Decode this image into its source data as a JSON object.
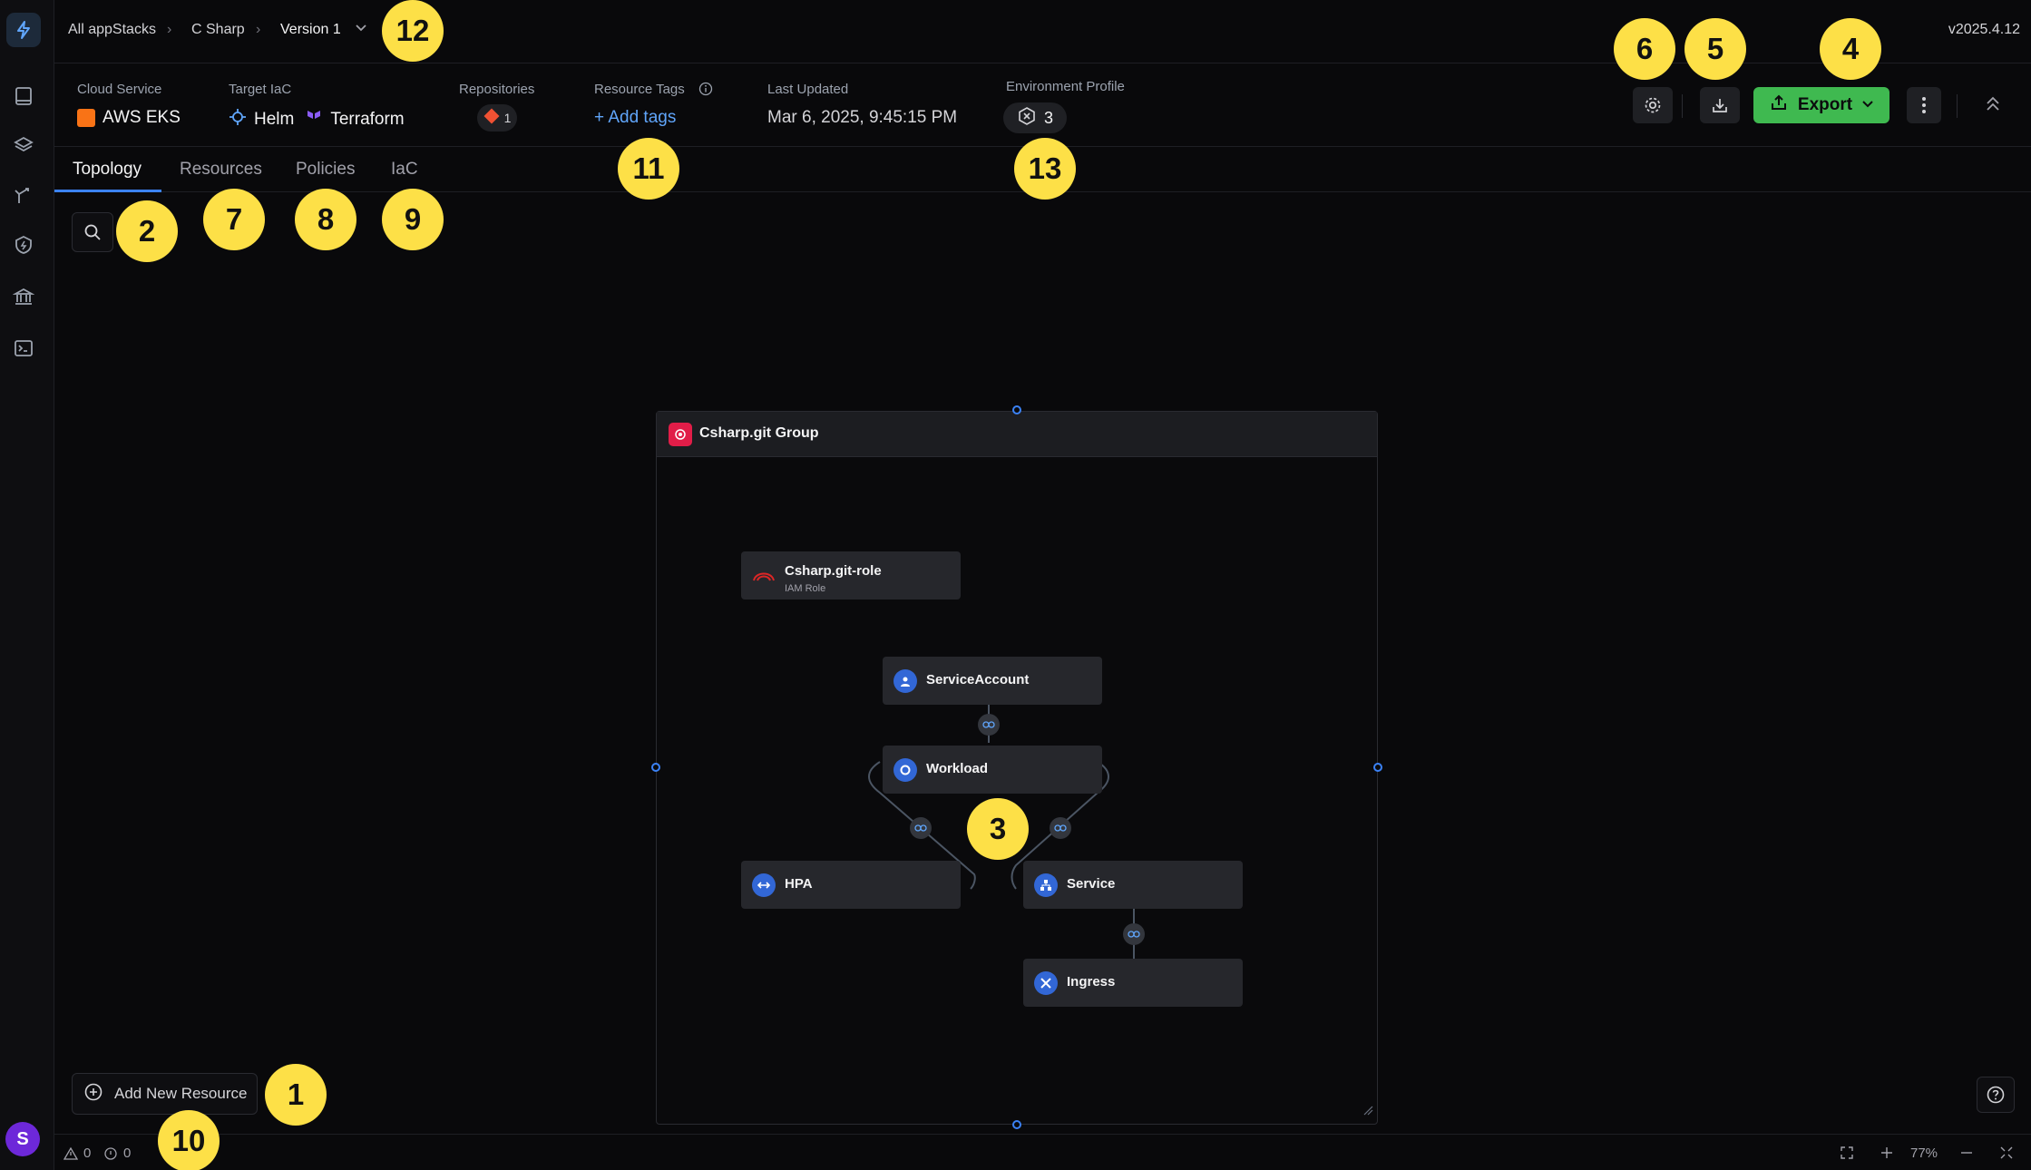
{
  "breadcrumb": {
    "items": [
      "All appStacks",
      "C Sharp"
    ],
    "version": "Version 1"
  },
  "app_version": "v2025.4.12",
  "header": {
    "cloud_service_label": "Cloud Service",
    "cloud_service_value": "AWS EKS",
    "target_iac_label": "Target IaC",
    "target_iac_values": [
      "Helm",
      "Terraform"
    ],
    "repositories_label": "Repositories",
    "repositories_count": "1",
    "resource_tags_label": "Resource Tags",
    "add_tags": "+ Add tags",
    "last_updated_label": "Last Updated",
    "last_updated_value": "Mar 6, 2025, 9:45:15 PM",
    "env_profile_label": "Environment Profile",
    "env_profile_count": "3",
    "export_label": "Export"
  },
  "tabs": [
    "Topology",
    "Resources",
    "Policies",
    "IaC"
  ],
  "active_tab": "Topology",
  "topology": {
    "group_title": "Csharp.git Group",
    "nodes": [
      {
        "label": "Csharp.git-role",
        "sub": "IAM Role",
        "icon": "iam-role-icon"
      },
      {
        "label": "ServiceAccount",
        "icon": "service-account-icon"
      },
      {
        "label": "Workload",
        "icon": "workload-icon"
      },
      {
        "label": "HPA",
        "icon": "hpa-icon"
      },
      {
        "label": "Service",
        "icon": "service-icon"
      },
      {
        "label": "Ingress",
        "icon": "ingress-icon"
      }
    ]
  },
  "add_resource_label": "Add New Resource",
  "status": {
    "warnings": "0",
    "errors": "0",
    "zoom": "77%"
  },
  "user_initial": "S",
  "markers": [
    "1",
    "2",
    "3",
    "4",
    "5",
    "6",
    "7",
    "8",
    "9",
    "10",
    "11",
    "12",
    "13"
  ],
  "colors": {
    "accent": "#3b82f6",
    "export": "#3fb950",
    "marker": "#fde047",
    "group_icon": "#e11d48",
    "node_icon": "#3267d6"
  }
}
